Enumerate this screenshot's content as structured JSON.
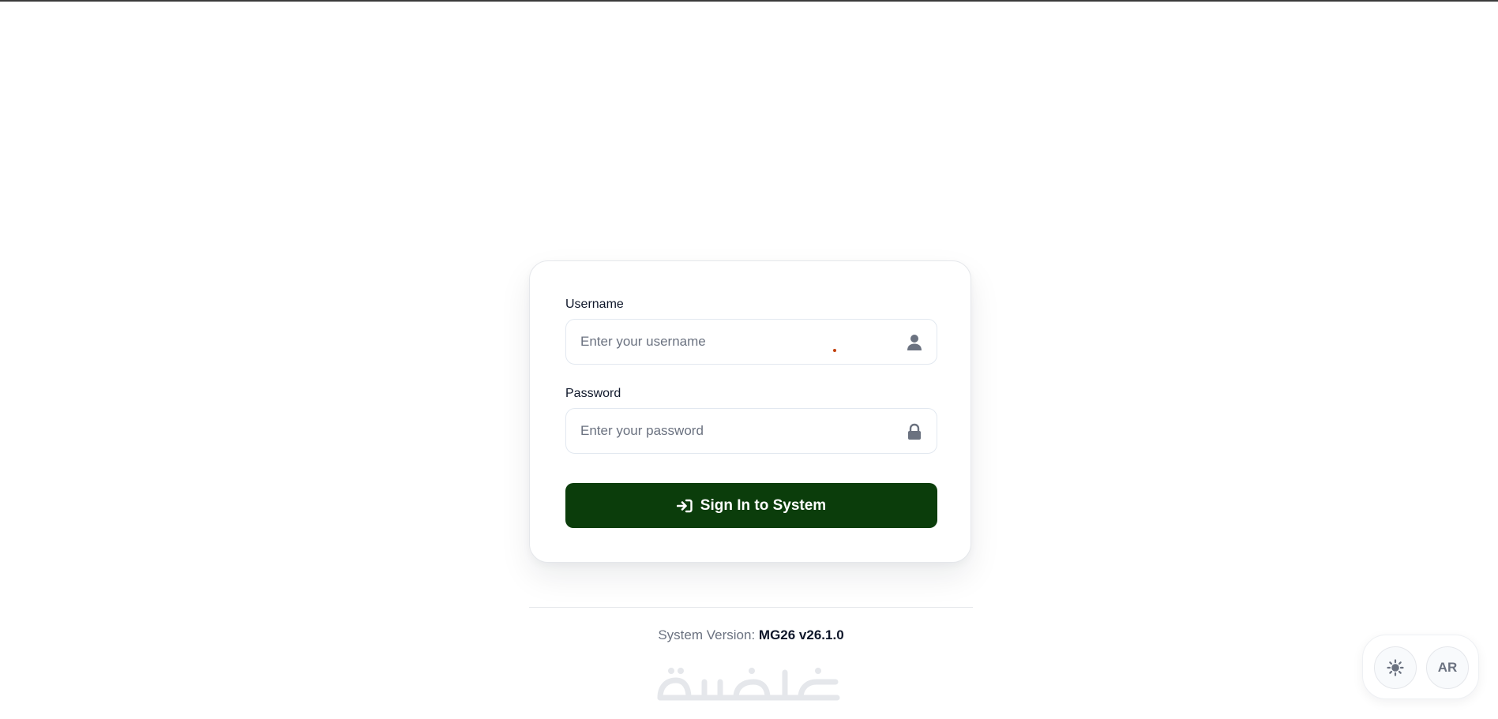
{
  "login_form": {
    "username_label": "Username",
    "username_placeholder": "Enter your username",
    "username_icon": "user-icon",
    "password_label": "Password",
    "password_placeholder": "Enter your password",
    "password_icon": "lock-icon",
    "signin_label": "Sign In to System",
    "signin_icon": "sign-in-icon"
  },
  "footer": {
    "version_label": "System Version:",
    "version_value": "MG26 v26.1.0",
    "logo_text": "خمسات"
  },
  "controls": {
    "theme_icon": "sun-icon",
    "language_label": "AR"
  },
  "colors": {
    "primary": "#0b3d0b",
    "muted_text": "#6b7280",
    "border": "#e5e7eb"
  }
}
